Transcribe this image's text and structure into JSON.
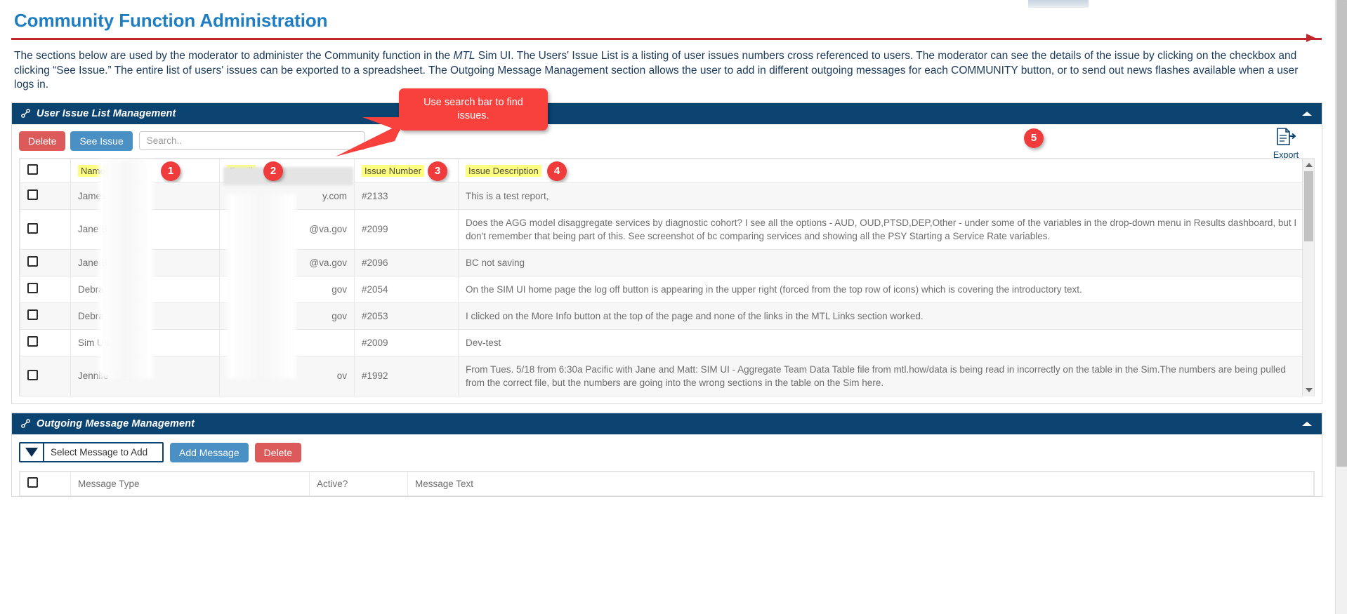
{
  "page": {
    "title": "Community Function Administration",
    "intro_part1": "The sections below are used by the moderator to administer the Community function in the ",
    "intro_italic": "MTL",
    "intro_part2": " Sim UI. The Users' Issue List is a listing of user issues numbers cross referenced to users. The moderator can see the details of the issue by clicking on the checkbox and clicking “See Issue.”  The entire list of users' issues can be exported to a spreadsheet. The Outgoing Message Management section allows the user to add in different outgoing messages for each COMMUNITY button, or to send out news flashes available when a user logs in."
  },
  "callout": {
    "text": "Use search bar to find issues."
  },
  "colors": {
    "panel_header": "#0b4371",
    "title_blue": "#1f7ec2",
    "rule_red": "#c1272d",
    "badge_red": "#ef3b3b",
    "callout_red": "#f8403c",
    "highlight_yellow": "#fdfd80",
    "btn_danger": "#dc5a5a",
    "btn_primary": "#4a90c4"
  },
  "issue_panel": {
    "title": "User Issue List Management",
    "collapse_icon": "chevron-up-icon",
    "link_icon": "link-icon",
    "toolbar": {
      "delete_label": "Delete",
      "see_issue_label": "See Issue",
      "search_placeholder": "Search..",
      "search_value": "",
      "export_label": "Export",
      "export_icon": "export-document-icon"
    },
    "badges": [
      "1",
      "2",
      "3",
      "4",
      "5"
    ],
    "columns": [
      "Name",
      "Email",
      "Issue Number",
      "Issue Description"
    ],
    "rows": [
      {
        "name": "James",
        "email": "y.com",
        "number": "#2133",
        "description": "This is a test report,"
      },
      {
        "name": "Jane B",
        "email": "@va.gov",
        "number": "#2099",
        "description": "Does the AGG model disaggregate services by diagnostic cohort? I see all the options - AUD, OUD,PTSD,DEP,Other - under some of the variables in the drop-down menu in Results dashboard, but I don't remember that being part of this. See screenshot of bc comparing services and showing all the PSY Starting a Service Rate variables."
      },
      {
        "name": "Jane B",
        "email": "@va.gov",
        "number": "#2096",
        "description": "BC not saving"
      },
      {
        "name": "Debra",
        "email": "gov",
        "number": "#2054",
        "description": "On the SIM UI home page the log off button is appearing in the upper right (forced from the top row of icons) which is covering the introductory text."
      },
      {
        "name": "Debra",
        "email": "gov",
        "number": "#2053",
        "description": "I clicked on the More Info button at the top of the page and none of the links in the MTL Links section worked."
      },
      {
        "name": "Sim Us",
        "email": "",
        "number": "#2009",
        "description": "Dev-test"
      },
      {
        "name": "Jennife",
        "email": "ov",
        "number": "#1992",
        "description": "From Tues. 5/18 from 6:30a Pacific with Jane and Matt: SIM UI - Aggregate Team Data Table file from mtl.how/data is being read in incorrectly on the table in the Sim.The numbers are being pulled from the correct file, but the numbers are going into the wrong sections in the table on the Sim here."
      }
    ]
  },
  "message_panel": {
    "title": "Outgoing Message Management",
    "collapse_icon": "chevron-up-icon",
    "link_icon": "link-icon",
    "toolbar": {
      "select_label": "Select Message to Add",
      "add_message_label": "Add Message",
      "delete_label": "Delete",
      "dropdown_icon": "triangle-down-icon"
    },
    "columns": [
      "Message Type",
      "Active?",
      "Message Text"
    ]
  }
}
